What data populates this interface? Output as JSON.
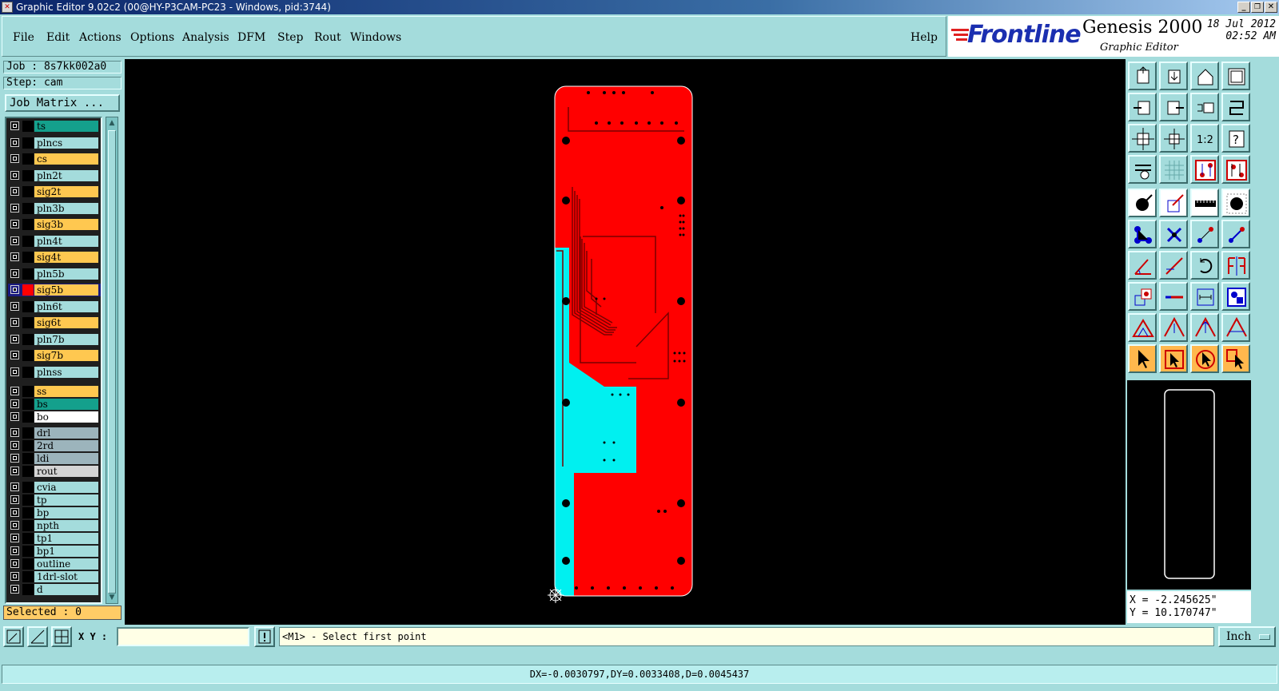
{
  "window": {
    "title": "Graphic Editor 9.02c2 (00@HY-P3CAM-PC23 - Windows, pid:3744)",
    "minimize": "_",
    "restore": "❐",
    "close": "✕"
  },
  "menu": [
    "File",
    "Edit",
    "Actions",
    "Options",
    "Analysis",
    "DFM",
    "Step",
    "Rout",
    "Windows"
  ],
  "help": "Help",
  "brand": {
    "logo": "Frontline",
    "product": "Genesis 2000",
    "subtitle": "Graphic Editor",
    "date": "18 Jul 2012",
    "time": "02:52 AM"
  },
  "job": {
    "job_line": "Job : 8s7kk002a0",
    "step_line": "Step: cam",
    "matrix_button": "Job Matrix ..."
  },
  "layers": [
    {
      "name": "ts",
      "color": "#14a08c",
      "swatch": "#000000"
    },
    {
      "name": "plncs",
      "color": "#a4dcdc",
      "swatch": "#000000"
    },
    {
      "name": "cs",
      "color": "#ffc850",
      "swatch": "#000000"
    },
    {
      "name": "pln2t",
      "color": "#a4dcdc",
      "swatch": "#000000"
    },
    {
      "name": "sig2t",
      "color": "#ffc850",
      "swatch": "#000000"
    },
    {
      "name": "pln3b",
      "color": "#a4dcdc",
      "swatch": "#000000"
    },
    {
      "name": "sig3b",
      "color": "#ffc850",
      "swatch": "#000000"
    },
    {
      "name": "pln4t",
      "color": "#a4dcdc",
      "swatch": "#000000"
    },
    {
      "name": "sig4t",
      "color": "#ffc850",
      "swatch": "#000000"
    },
    {
      "name": "pln5b",
      "color": "#a4dcdc",
      "swatch": "#000000"
    },
    {
      "name": "sig5b",
      "color": "#ffc850",
      "swatch": "#ff0000",
      "active": true
    },
    {
      "name": "pln6t",
      "color": "#a4dcdc",
      "swatch": "#000000"
    },
    {
      "name": "sig6t",
      "color": "#ffc850",
      "swatch": "#000000"
    },
    {
      "name": "pln7b",
      "color": "#a4dcdc",
      "swatch": "#000000"
    },
    {
      "name": "sig7b",
      "color": "#ffc850",
      "swatch": "#000000"
    },
    {
      "name": "plnss",
      "color": "#a4dcdc",
      "swatch": "#000000"
    },
    {
      "name": "ss",
      "color": "#ffc850",
      "swatch": "#000000"
    },
    {
      "name": "bs",
      "color": "#14a08c",
      "swatch": "#000000"
    },
    {
      "name": "bo",
      "color": "#ffffff",
      "swatch": "#000000"
    },
    {
      "name": "drl",
      "color": "#9cb4bc",
      "swatch": "#000000"
    },
    {
      "name": "2rd",
      "color": "#9cb4bc",
      "swatch": "#000000"
    },
    {
      "name": "ldi",
      "color": "#9cb4bc",
      "swatch": "#000000"
    },
    {
      "name": "rout",
      "color": "#d4d4d4",
      "swatch": "#000000"
    },
    {
      "name": "cvia",
      "color": "#a4dcdc",
      "swatch": "#000000"
    },
    {
      "name": "tp",
      "color": "#a4dcdc",
      "swatch": "#000000"
    },
    {
      "name": "bp",
      "color": "#a4dcdc",
      "swatch": "#000000"
    },
    {
      "name": "npth",
      "color": "#a4dcdc",
      "swatch": "#000000"
    },
    {
      "name": "tp1",
      "color": "#a4dcdc",
      "swatch": "#000000"
    },
    {
      "name": "bp1",
      "color": "#a4dcdc",
      "swatch": "#000000"
    },
    {
      "name": "outline",
      "color": "#a4dcdc",
      "swatch": "#000000"
    },
    {
      "name": "1drl-slot",
      "color": "#a4dcdc",
      "swatch": "#000000"
    },
    {
      "name": "d",
      "color": "#a4dcdc",
      "swatch": "#000000"
    }
  ],
  "selected_text": "Selected : 0",
  "coords": {
    "x": "X = -2.245625\"",
    "y": "Y = 10.170747\""
  },
  "command": {
    "xy_label": "X Y :",
    "xy_value": "",
    "prompt": "<M1> - Select first point",
    "unit": "Inch"
  },
  "status": "DX=-0.0030797,DY=0.0033408,D=0.0045437",
  "toolbar_icons": [
    "open-icon",
    "save-icon",
    "home-icon",
    "window-icon",
    "prev-icon",
    "next-icon",
    "undo-icon",
    "redo-icon",
    "zoom-fit-icon",
    "zoom-center-icon",
    "zoom-1to2-icon",
    "help-icon",
    "tools-icon",
    "grid-icon",
    "snap-red-icon",
    "snap-multi-icon",
    "pad-icon",
    "measure-pad-icon",
    "ruler-icon",
    "drill-icon",
    "connect-icon",
    "cross-icon",
    "line-icon",
    "arc-icon",
    "angle-icon",
    "slash-icon",
    "rotate-icon",
    "mirror-icon",
    "move-icon",
    "dash-icon",
    "dimension-icon",
    "group-icon",
    "triangle-icon",
    "triangle-up-icon",
    "triangle-arrow-icon",
    "triangle-measure-icon",
    "pointer-icon",
    "pointer-box-icon",
    "pointer-circle-icon",
    "pointer-multi-icon"
  ],
  "colors": {
    "board_red": "#ff0000",
    "board_cyan": "#00f0f0",
    "trace_dark": "#8a0000",
    "panel_teal": "#a4dcdc"
  }
}
